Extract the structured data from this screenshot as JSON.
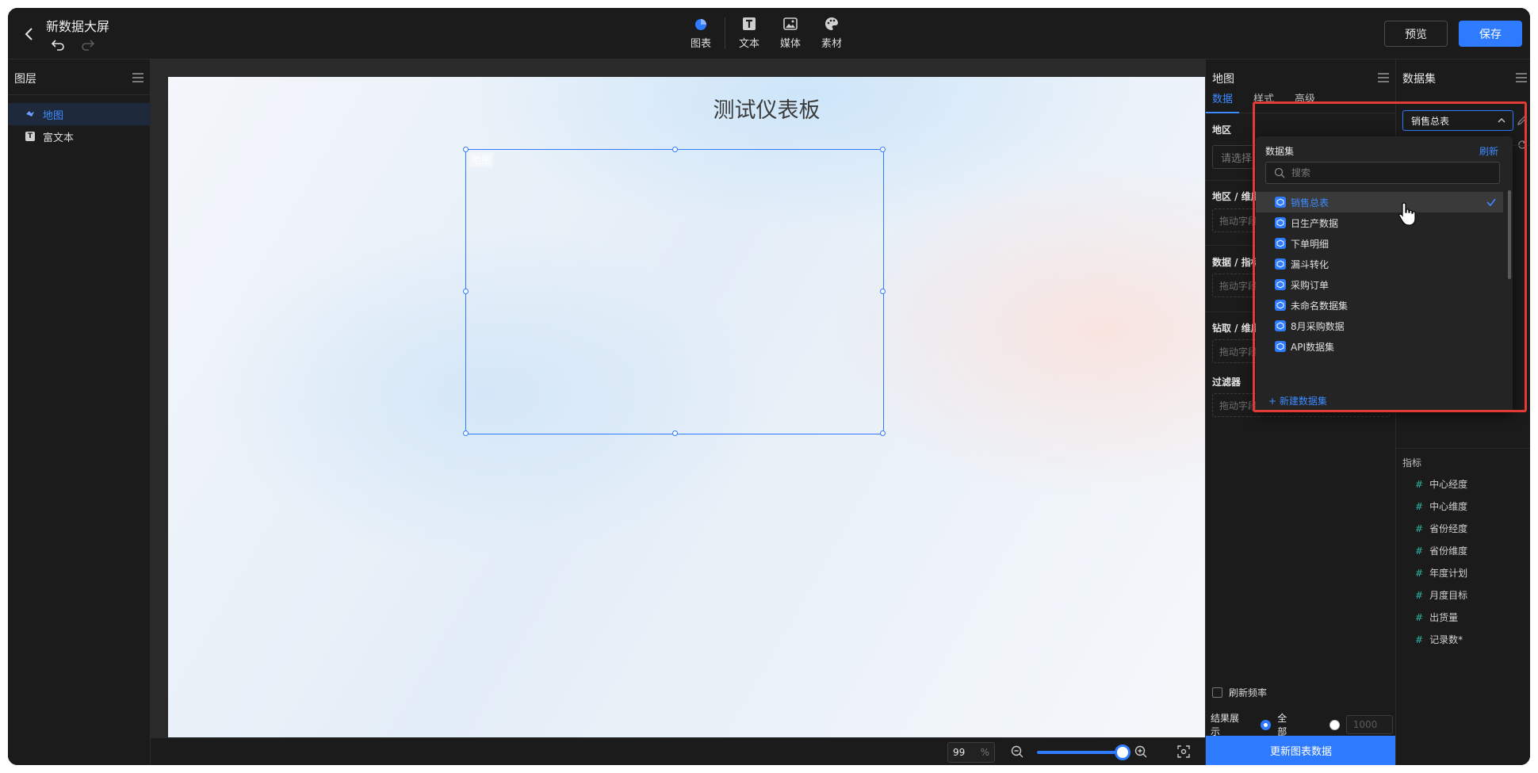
{
  "header": {
    "title": "新数据大屏",
    "tools": [
      {
        "label": "图表",
        "icon": "pie-chart-icon"
      },
      {
        "label": "文本",
        "icon": "text-icon"
      },
      {
        "label": "媒体",
        "icon": "image-icon"
      },
      {
        "label": "素材",
        "icon": "palette-icon"
      }
    ],
    "preview_label": "预览",
    "save_label": "保存"
  },
  "layers": {
    "title": "图层",
    "items": [
      {
        "label": "地图",
        "icon": "map-icon",
        "active": true
      },
      {
        "label": "富文本",
        "icon": "text-icon",
        "active": false
      }
    ]
  },
  "canvas": {
    "title": "测试仪表板",
    "map_label": "地图"
  },
  "zoom": {
    "value": "99",
    "unit": "%",
    "level": 0.99
  },
  "props": {
    "title": "地图",
    "tabs": [
      "数据",
      "样式",
      "高级"
    ],
    "active_tab": "数据",
    "region_label": "地区",
    "region_placeholder": "请选择",
    "sections": [
      {
        "label": "地区 / 维度",
        "drop": "拖动字段至此处"
      },
      {
        "label": "数据 / 指标",
        "drop": "拖动字段至此处"
      },
      {
        "label": "钻取 / 维度",
        "drop": "拖动字段至此处"
      },
      {
        "label": "过滤器",
        "drop": "拖动字段至此处"
      }
    ],
    "refresh_freq": "刷新频率",
    "result_label": "结果展示",
    "result_all": "全部",
    "result_limit_placeholder": "1000",
    "update_button": "更新图表数据"
  },
  "dataset": {
    "title": "数据集",
    "selected": "销售总表",
    "metrics_title": "指标",
    "metrics": [
      "中心经度",
      "中心维度",
      "省份经度",
      "省份维度",
      "年度计划",
      "月度目标",
      "出货量",
      "记录数*"
    ]
  },
  "popup": {
    "header": "数据集",
    "refresh": "刷新",
    "search_placeholder": "搜索",
    "options": [
      "销售总表",
      "日生产数据",
      "下单明细",
      "漏斗转化",
      "采购订单",
      "未命名数据集",
      "8月采购数据",
      "API数据集"
    ],
    "selected_index": 0,
    "new_label": "新建数据集"
  },
  "colors": {
    "accent": "#2f7bff",
    "highlight": "#e53935",
    "panel_bg": "#1b1b1b",
    "metric_hash": "#2bb3a1"
  }
}
